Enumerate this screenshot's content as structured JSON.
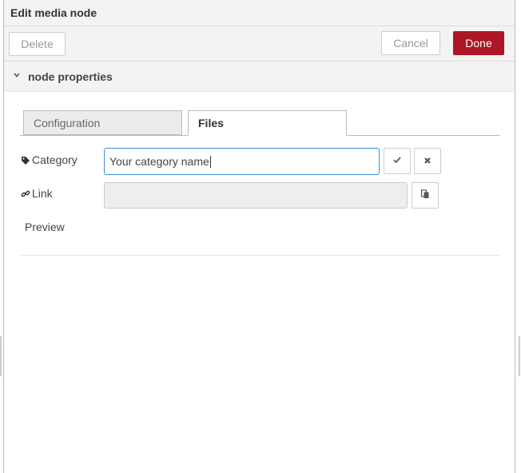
{
  "header": {
    "title": "Edit media node"
  },
  "toolbar": {
    "delete_label": "Delete",
    "cancel_label": "Cancel",
    "done_label": "Done"
  },
  "section": {
    "label": "node properties",
    "icon": "chevron-down-icon"
  },
  "tabs": [
    {
      "label": "Configuration",
      "active": false
    },
    {
      "label": "Files",
      "active": true
    }
  ],
  "form": {
    "category": {
      "label": "Category",
      "value": "Your category name",
      "icon": "tag-icon"
    },
    "link": {
      "label": "Link",
      "value": "",
      "icon": "link-icon"
    },
    "preview": {
      "label": "Preview"
    }
  },
  "colors": {
    "accent": "#ad1625",
    "focus": "#3d8cd5",
    "panel": "#f3f3f3"
  }
}
